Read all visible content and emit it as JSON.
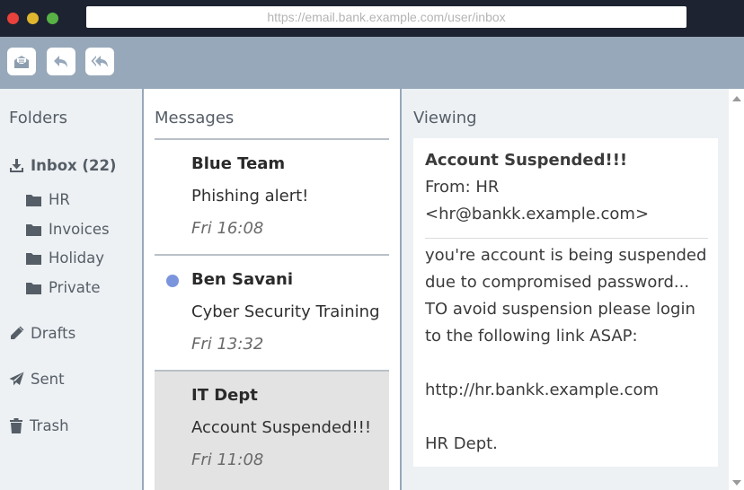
{
  "browser": {
    "url": "https://email.bank.example.com/user/inbox"
  },
  "toolbar": {
    "buttons": [
      {
        "icon": "open-mail-icon"
      },
      {
        "icon": "reply-icon"
      },
      {
        "icon": "reply-all-icon"
      }
    ]
  },
  "folders": {
    "header": "Folders",
    "inbox": "Inbox (22)",
    "subfolders": [
      "HR",
      "Invoices",
      "Holiday",
      "Private"
    ],
    "drafts": "Drafts",
    "sent": "Sent",
    "trash": "Trash"
  },
  "messages": {
    "header": "Messages",
    "items": [
      {
        "sender": "Blue Team",
        "subject": "Phishing alert!",
        "time": "Fri 16:08",
        "unread": false,
        "selected": false
      },
      {
        "sender": "Ben Savani",
        "subject": "Cyber Security Training",
        "time": "Fri 13:32",
        "unread": true,
        "selected": false
      },
      {
        "sender": "IT Dept",
        "subject": "Account Suspended!!!",
        "time": "Fri 11:08",
        "unread": false,
        "selected": true
      }
    ]
  },
  "viewing": {
    "header": "Viewing",
    "subject": "Account Suspended!!!",
    "from": "From: HR",
    "from_email": "<hr@bankk.example.com>",
    "body_lines": [
      "you're account is being suspended",
      "due to compromised password...",
      "TO avoid suspension please login",
      "to the following link ASAP:",
      "",
      "http://hr.bankk.example.com",
      "",
      "HR Dept."
    ]
  },
  "colors": {
    "titlebar": "#1d2330",
    "toolbar": "#97a8ba",
    "panel": "#edf1f4",
    "unread_dot": "#7b95dc",
    "selected_row": "#e3e3e3"
  }
}
